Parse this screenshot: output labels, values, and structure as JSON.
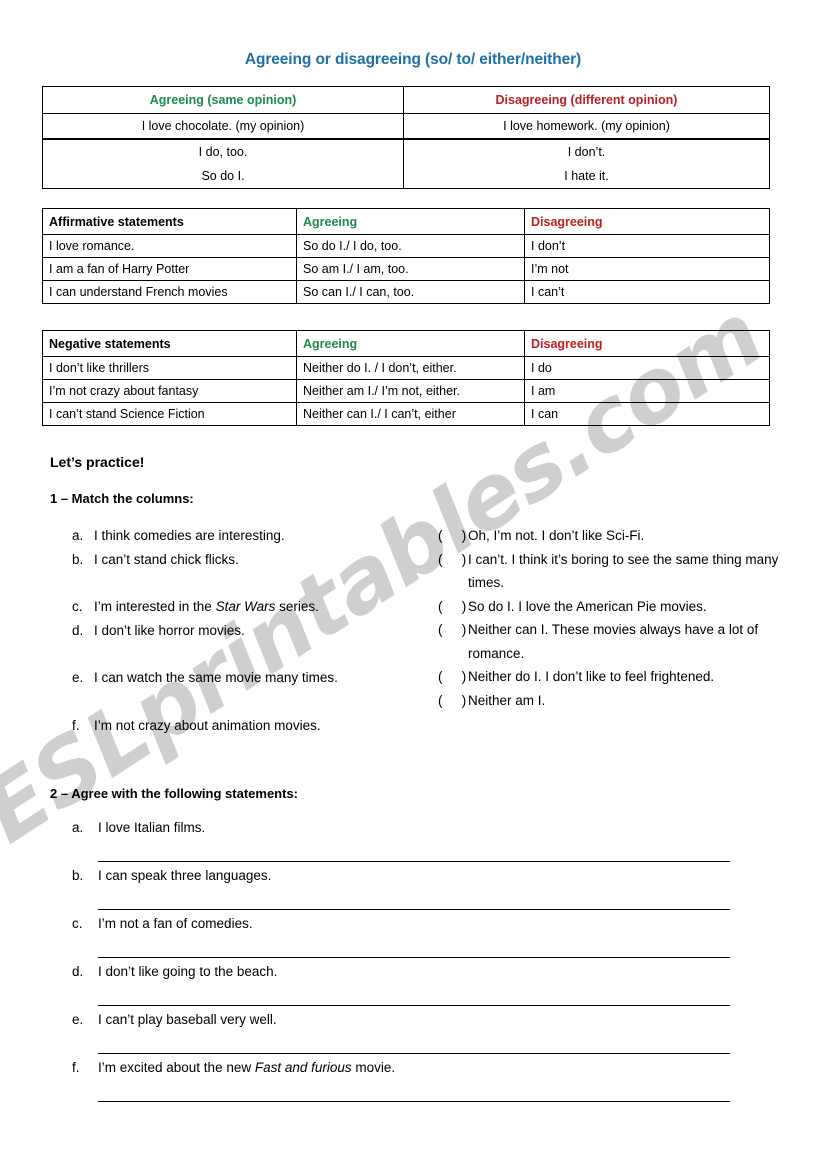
{
  "title": "Agreeing or disagreeing (so/ to/ either/neither)",
  "watermark": "ESLprintables.com",
  "colors": {
    "title": "#1F6FA8",
    "agreeing": "#1F8A4C",
    "disagreeing": "#BB1F22"
  },
  "table1": {
    "headers": [
      "Agreeing (same opinion)",
      "Disagreeing (different opinion)"
    ],
    "rows": [
      [
        "I love chocolate. (my opinion)",
        "I love homework. (my opinion)"
      ],
      [
        "I do, too.",
        "I don’t."
      ],
      [
        "So do I.",
        "I hate it."
      ]
    ]
  },
  "table2": {
    "headers": [
      "Affirmative statements",
      "Agreeing",
      "Disagreeing"
    ],
    "rows": [
      [
        "I love romance.",
        "So do I./ I do, too.",
        "I don’t"
      ],
      [
        "I am a fan of Harry Potter",
        "So am I./ I am, too.",
        "I’m not"
      ],
      [
        "I can understand French movies",
        "So can I./ I can, too.",
        "I can’t"
      ]
    ]
  },
  "table3": {
    "headers": [
      "Negative statements",
      "Agreeing",
      "Disagreeing"
    ],
    "rows": [
      [
        "I don’t like thrillers",
        "Neither do I. / I don’t, either.",
        "I do"
      ],
      [
        "I’m not crazy about fantasy",
        "Neither am I./ I’m not, either.",
        "I am"
      ],
      [
        "I can’t stand Science Fiction",
        "Neither can I./ I can’t, either",
        "I can"
      ]
    ]
  },
  "practice_heading": "Let’s practice!",
  "exercise1": {
    "title": "1 – Match the columns:",
    "left": [
      {
        "label": "a.",
        "text": "I think comedies are interesting."
      },
      {
        "label": "b.",
        "text": "I can’t stand chick flicks."
      },
      {
        "label": "c.",
        "text_before": "I’m interested in the ",
        "italic": "Star Wars",
        "text_after": " series."
      },
      {
        "label": "d.",
        "text": "I don’t like horror movies."
      },
      {
        "label": "e.",
        "text": "I can watch the same movie many times."
      },
      {
        "label": "f.",
        "text": "I’m not crazy about animation movies."
      }
    ],
    "blank": "(",
    "blank_close": ")",
    "right": [
      {
        "text": "Oh, I’m not. I don’t like Sci-Fi."
      },
      {
        "text": "I can’t. I think it’s boring to see the same thing many times."
      },
      {
        "text": "So do I. I love the American Pie movies."
      },
      {
        "text": "Neither can I. These movies always have a lot of romance."
      },
      {
        "text": "Neither do I. I don’t like to feel frightened."
      },
      {
        "text": "Neither am I."
      }
    ]
  },
  "exercise2": {
    "title": "2 – Agree with the following statements:",
    "items": [
      {
        "label": "a.",
        "text": "I love Italian films."
      },
      {
        "label": "b.",
        "text": "I can speak three languages."
      },
      {
        "label": "c.",
        "text": "I’m not a fan of comedies."
      },
      {
        "label": "d.",
        "text": "I don’t like going to the beach."
      },
      {
        "label": "e.",
        "text": "I can’t play baseball very well."
      },
      {
        "label": "f.",
        "text_before": "I’m excited about the new ",
        "italic": "Fast and furious",
        "text_after": " movie."
      }
    ]
  }
}
